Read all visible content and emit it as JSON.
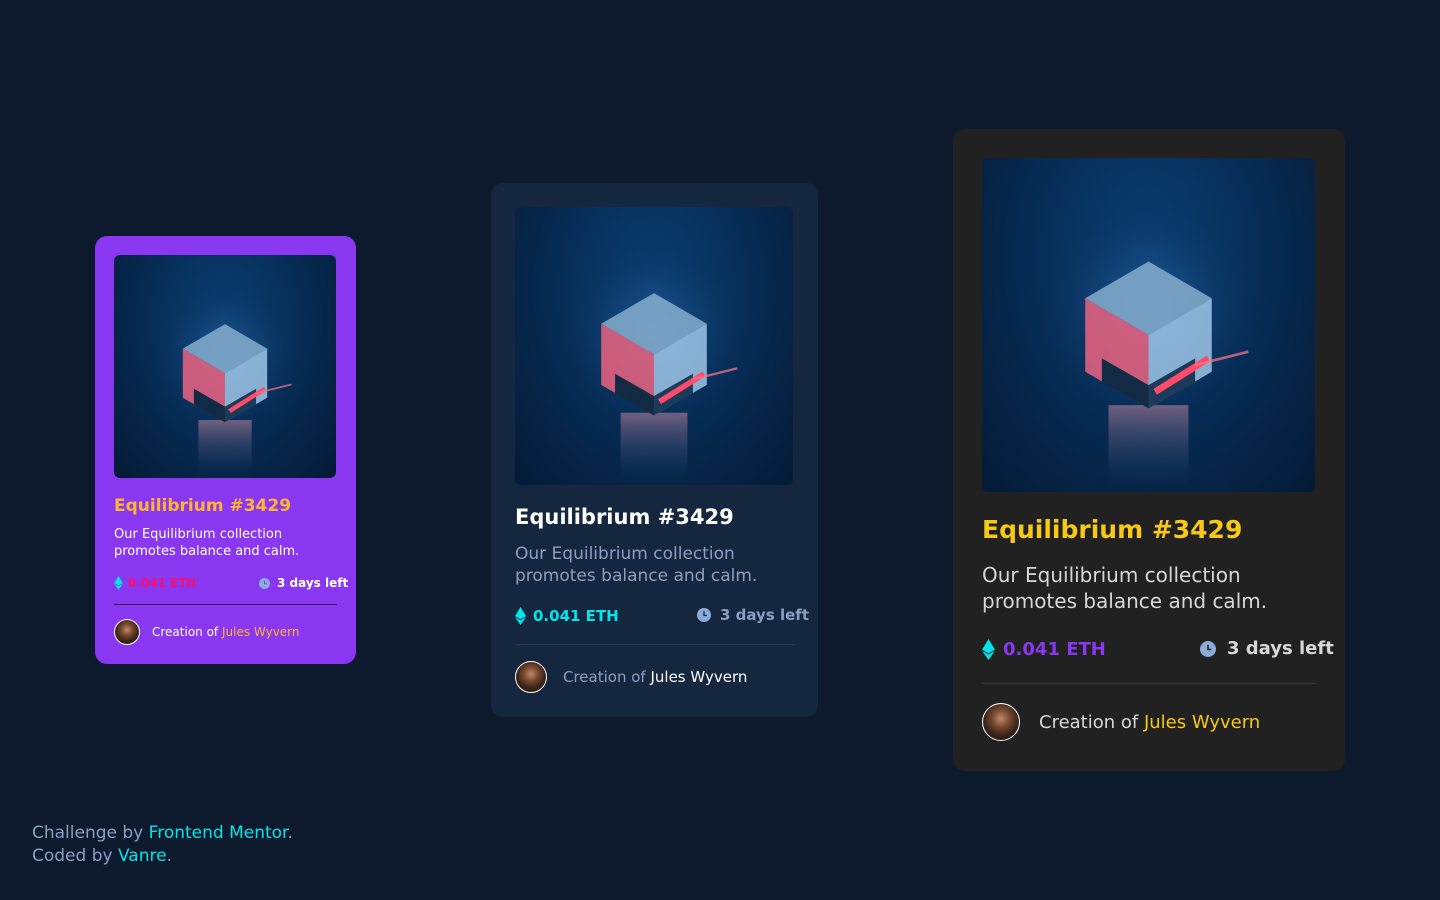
{
  "cards": [
    {
      "title": "Equilibrium #3429",
      "description": "Our Equilibrium collection promotes balance and calm.",
      "price": "0.041 ETH",
      "days_left": "3 days left",
      "creation_prefix": "Creation of",
      "creator_name": "Jules Wyvern",
      "colors": {
        "background": "#8a37f2",
        "title": "#ffb52e",
        "price": "#ff0c6a",
        "creator": "#ffb52e"
      }
    },
    {
      "title": "Equilibrium #3429",
      "description": "Our Equilibrium collection promotes balance and calm.",
      "price": "0.041 ETH",
      "days_left": "3 days left",
      "creation_prefix": "Creation of",
      "creator_name": "Jules Wyvern",
      "colors": {
        "background": "#15263f",
        "title": "#ffffff",
        "price": "#00e6ea",
        "creator": "#ffffff"
      }
    },
    {
      "title": "Equilibrium #3429",
      "description": "Our Equilibrium collection promotes balance and calm.",
      "price": "0.041 ETH",
      "days_left": "3 days left",
      "creation_prefix": "Creation of",
      "creator_name": "Jules Wyvern",
      "colors": {
        "background": "#212121",
        "title": "#f7c815",
        "price": "#8a37f2",
        "creator": "#f7c815"
      }
    }
  ],
  "icons": {
    "price": "ethereum-icon",
    "time": "clock-icon",
    "creator": "avatar"
  },
  "footer": {
    "challenge_prefix": "Challenge by",
    "challenge_link": "Frontend Mentor",
    "challenge_suffix": ".",
    "coded_prefix": "Coded by",
    "coded_link": "Vanre",
    "coded_suffix": "."
  },
  "colors": {
    "page_background": "#0d192c",
    "link": "#00e6ea"
  }
}
